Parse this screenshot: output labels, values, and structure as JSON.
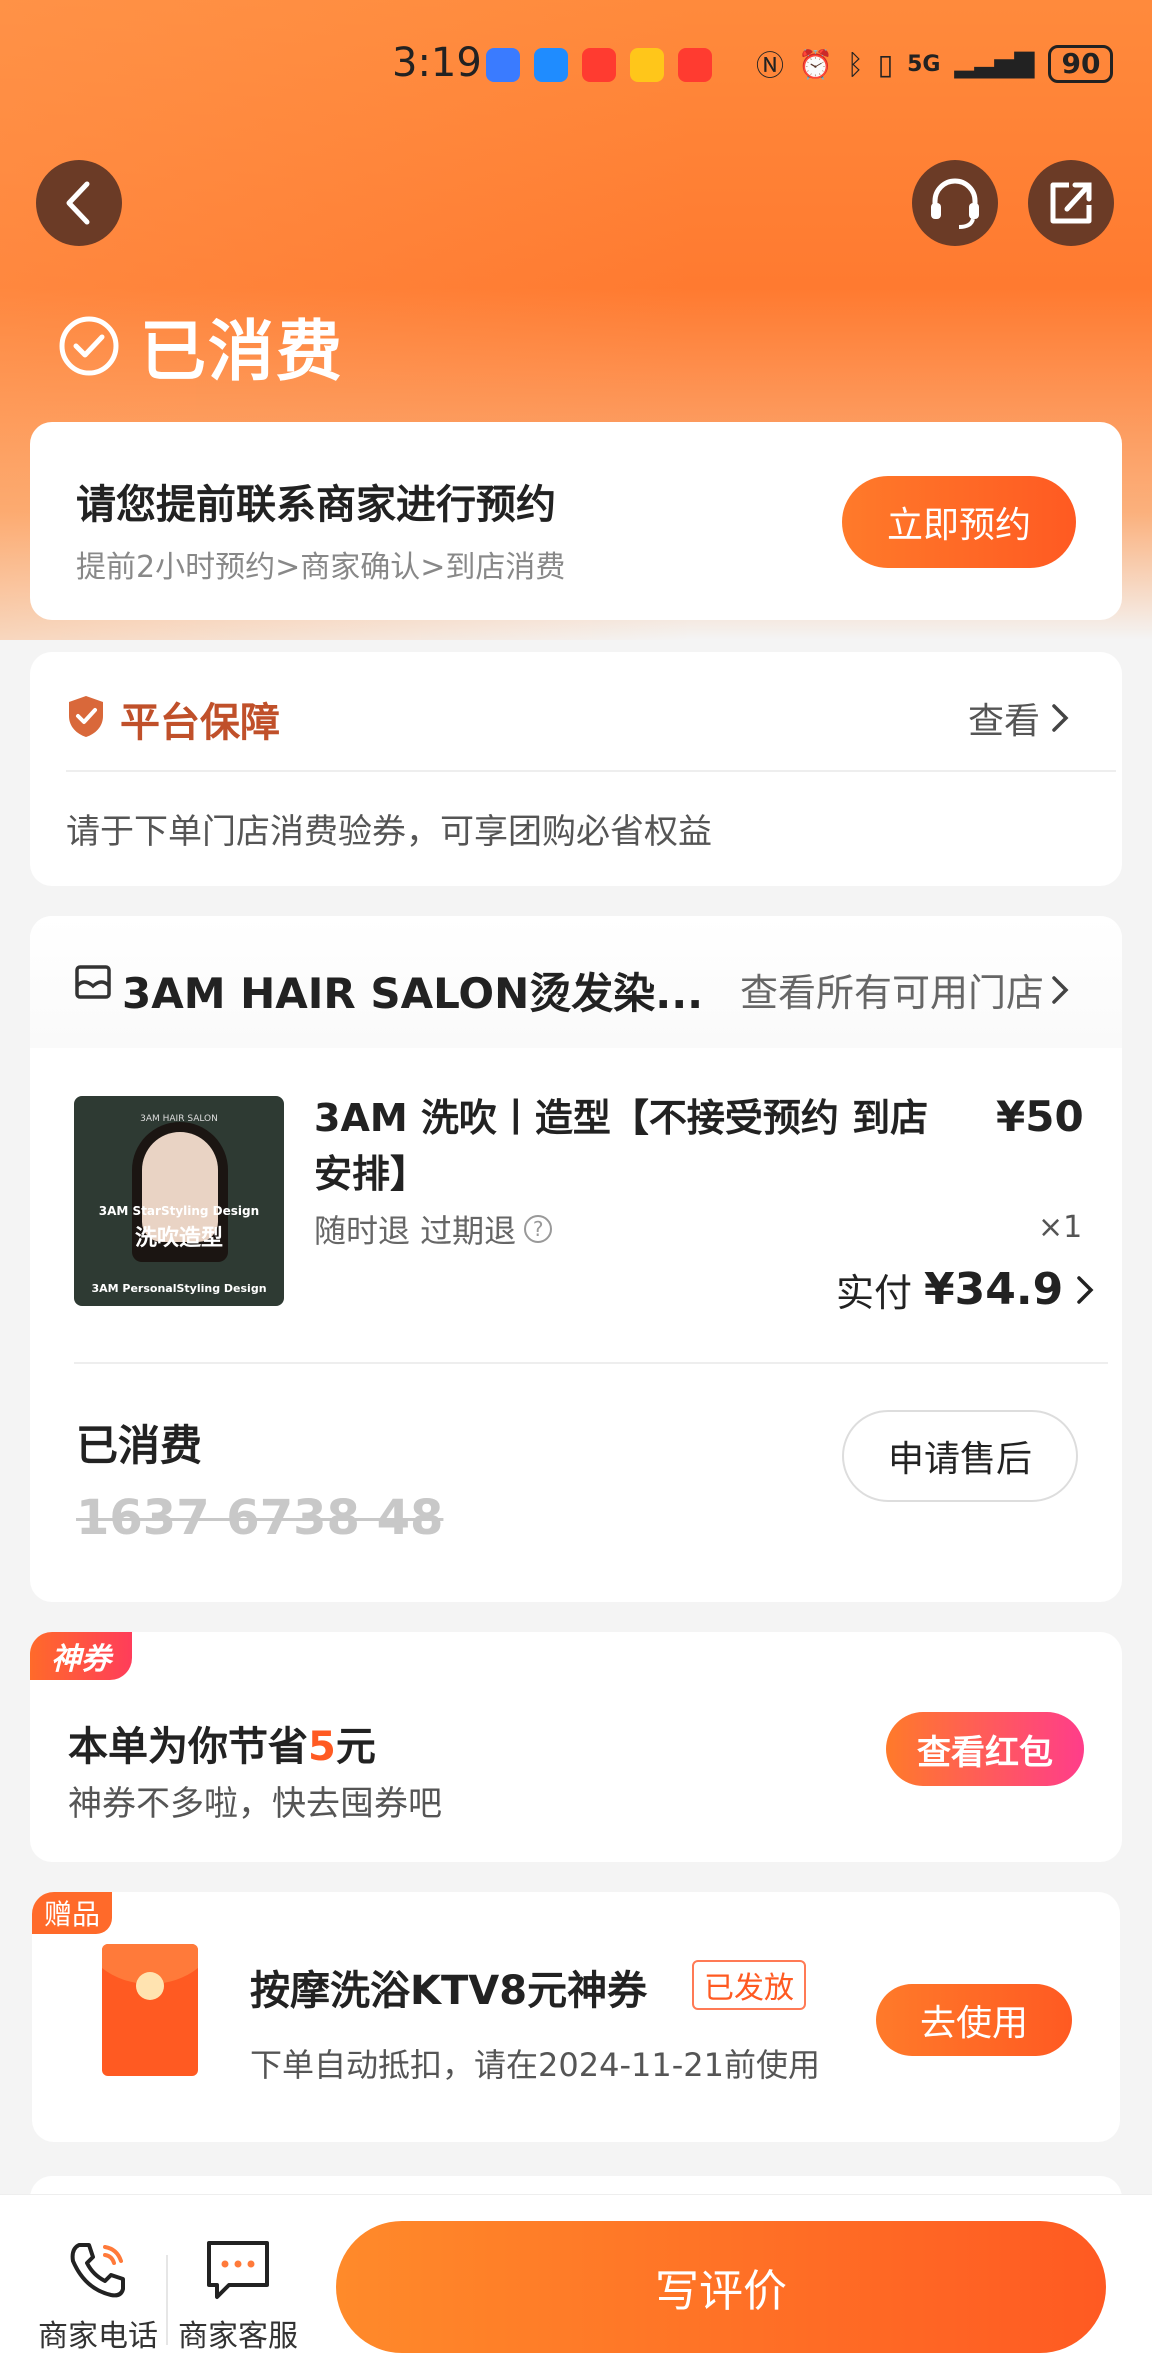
{
  "status_bar": {
    "time": "3:19",
    "network": "5G",
    "battery": "90"
  },
  "header": {
    "title": "已消费"
  },
  "appointment": {
    "title": "请您提前联系商家进行预约",
    "subtitle": "提前2小时预约>商家确认>到店消费",
    "button": "立即预约"
  },
  "guarantee": {
    "title": "平台保障",
    "view": "查看",
    "desc": "请于下单门店消费验券，可享团购必省权益"
  },
  "order": {
    "store_name": "3AM HAIR SALON烫发染...",
    "store_link": "查看所有可用门店",
    "thumb": {
      "brand": "3AM HAIR SALON",
      "line1": "3AM StarStyling Design",
      "line2": "洗吹造型",
      "line3": "3AM PersonalStyling Design"
    },
    "product_name": "3AM 洗吹丨造型【不接受预约 到店安排】",
    "price": "¥50",
    "refund": "随时退 过期退",
    "help_glyph": "?",
    "quantity": "×1",
    "paid_label": "实付",
    "paid_amount": "¥34.9",
    "status": "已消费",
    "code": "1637 6738 48",
    "after_sale": "申请售后"
  },
  "coupon": {
    "tag": "神券",
    "save_prefix": "本单为你节省",
    "save_amount": "5",
    "save_unit": "元",
    "subtitle": "神券不多啦，快去囤券吧",
    "button": "查看红包"
  },
  "gift": {
    "tag": "赠品",
    "title": "按摩洗浴KTV8元神券",
    "badge": "已发放",
    "subtitle": "下单自动抵扣，请在2024-11-21前使用",
    "button": "去使用"
  },
  "bottom_bar": {
    "phone": "商家电话",
    "service": "商家客服",
    "review": "写评价"
  },
  "colors": {
    "accent": "#ff5a22",
    "brown": "#6b3b26"
  }
}
